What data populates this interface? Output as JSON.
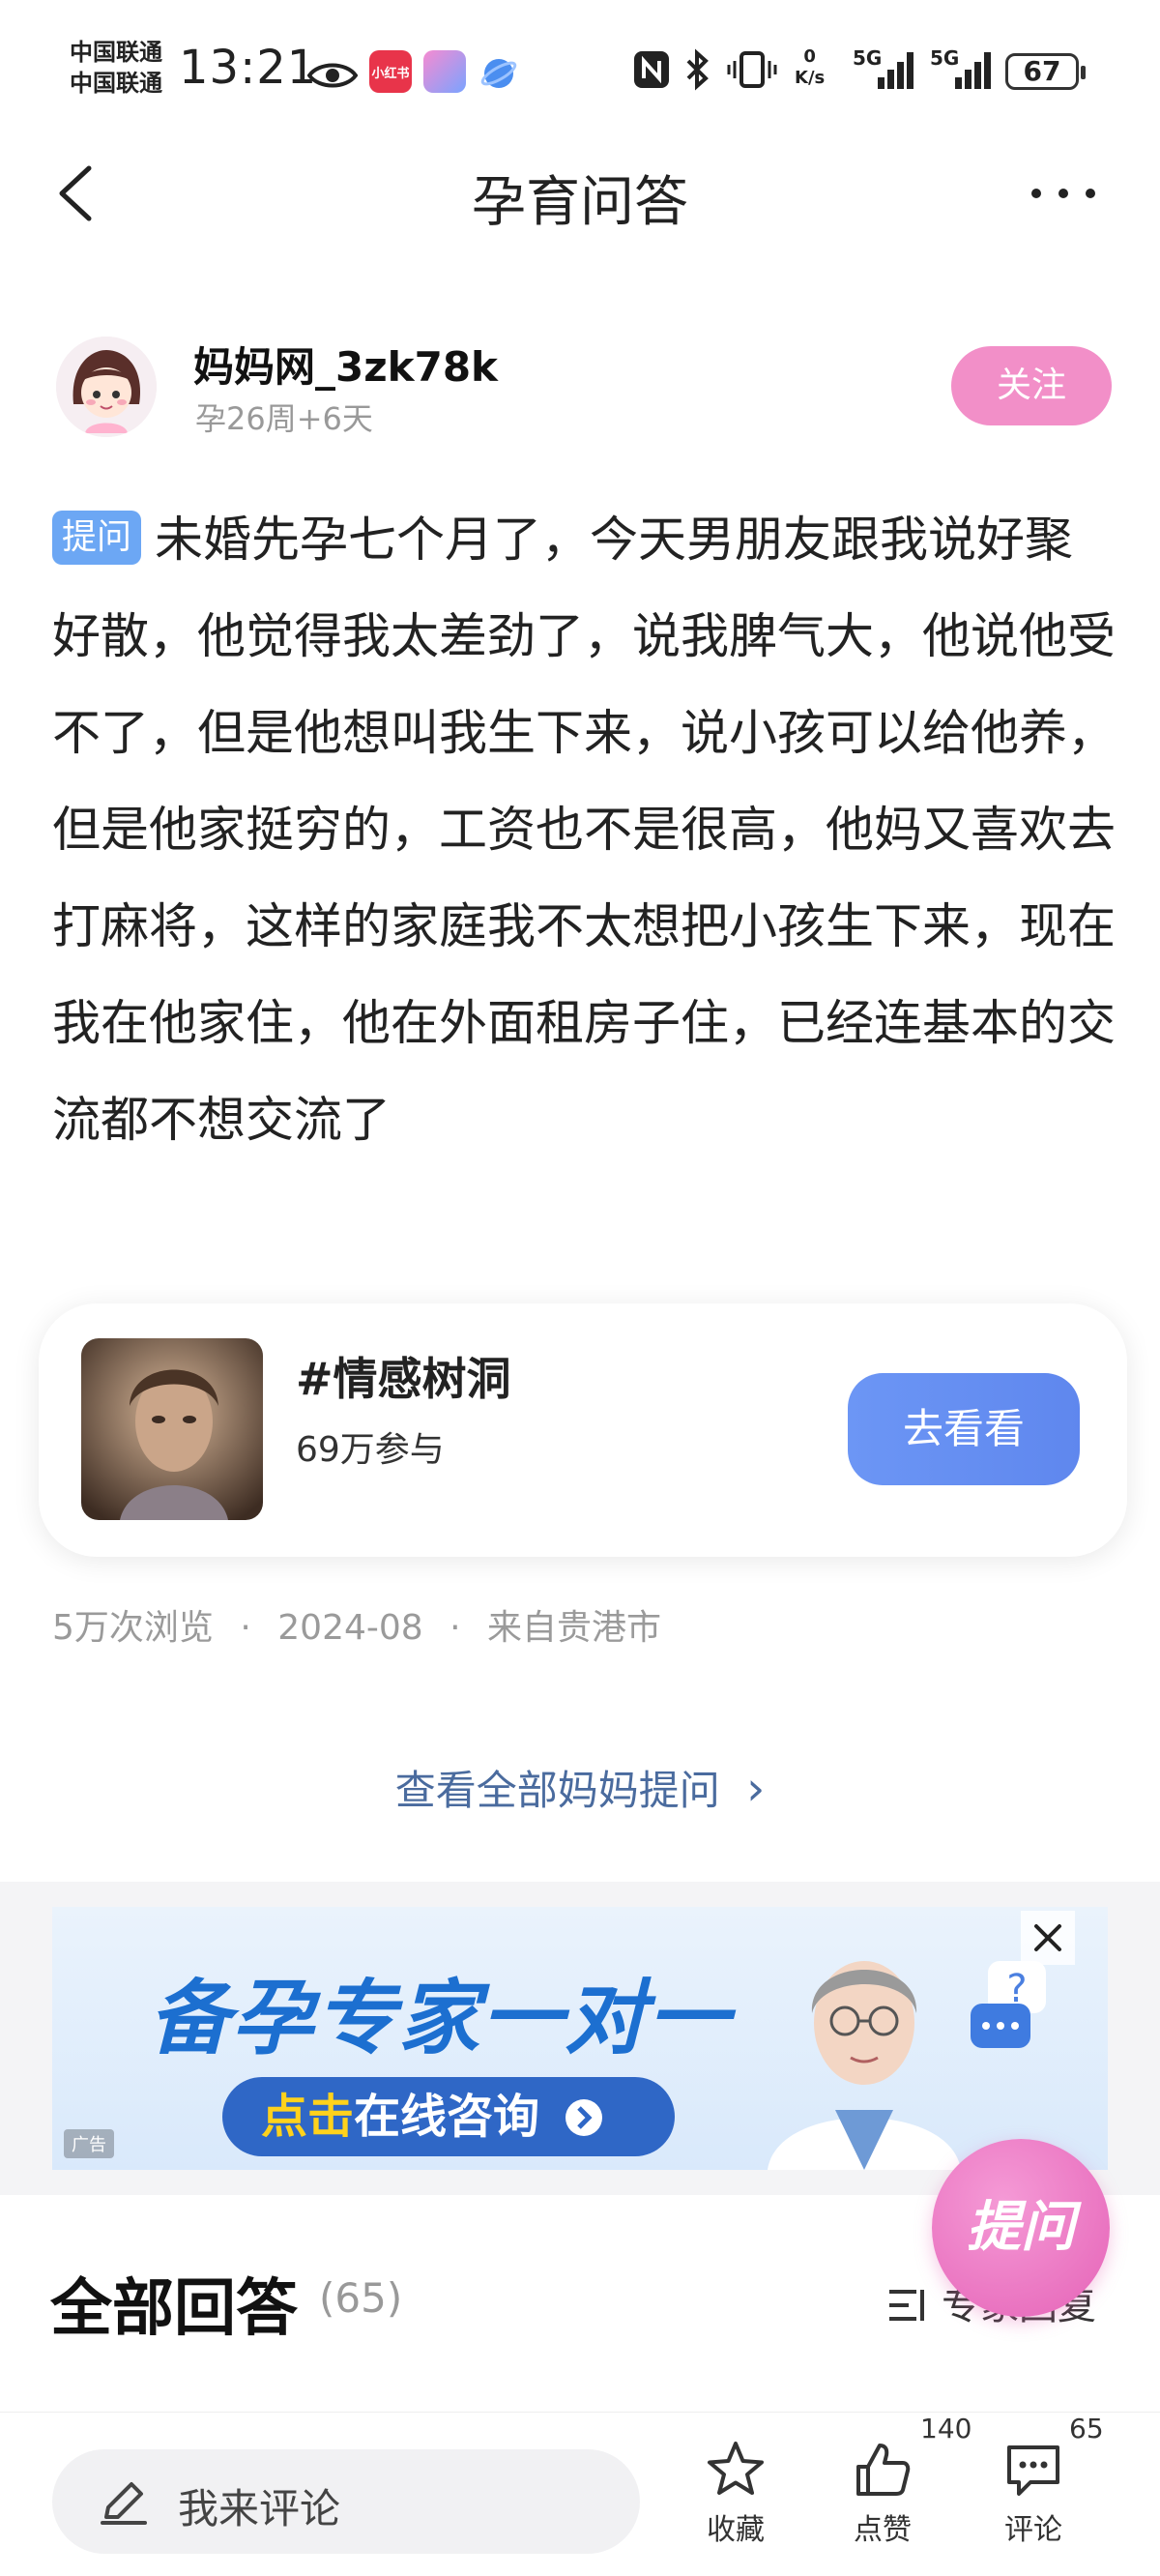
{
  "status_bar": {
    "carrier_1": "中国联通",
    "carrier_2": "中国联通",
    "time": "13:21",
    "app_badge_1": "小红书",
    "netspeed_value": "0",
    "netspeed_unit": "K/s",
    "signal_1": "5G",
    "signal_2": "5G",
    "battery": "67"
  },
  "nav": {
    "title": "孕育问答"
  },
  "author": {
    "name": "妈妈网_3zk78k",
    "pregnancy": "孕26周+6天",
    "follow_label": "关注"
  },
  "question": {
    "tag": "提问",
    "text": "未婚先孕七个月了，今天男朋友跟我说好聚好散，他觉得我太差劲了，说我脾气大，他说他受不了，但是他想叫我生下来，说小孩可以给他养，但是他家挺穷的，工资也不是很高，他妈又喜欢去打麻将，这样的家庭我不太想把小孩生下来，现在我在他家住，他在外面租房子住，已经连基本的交流都不想交流了"
  },
  "topic": {
    "title": "#情感树洞",
    "participants": "69万参与",
    "button": "去看看"
  },
  "meta": {
    "views": "5万次浏览",
    "date": "2024-08",
    "location": "来自贵港市",
    "separator": "·"
  },
  "view_all": {
    "label": "查看全部妈妈提问",
    "arrow": "›"
  },
  "ad": {
    "title": "备孕专家一对一",
    "button_highlight": "点击",
    "button_rest": "在线咨询",
    "tag": "广告"
  },
  "ask_fab": {
    "label": "提问"
  },
  "answers": {
    "title": "全部回答",
    "count": "(65)",
    "expert_reply": "专家回复"
  },
  "bottom_bar": {
    "comment_placeholder": "我来评论",
    "favorite_label": "收藏",
    "like_label": "点赞",
    "like_count": "140",
    "comment_label": "评论",
    "comment_count": "65"
  },
  "colors": {
    "follow_pink": "#f28fc8",
    "tag_blue": "#6ca7f4",
    "button_blue": "#5f87ee",
    "link_blue": "#4a6b9e",
    "ad_blue": "#1c6fd0",
    "fab_pink": "#e563b7"
  }
}
